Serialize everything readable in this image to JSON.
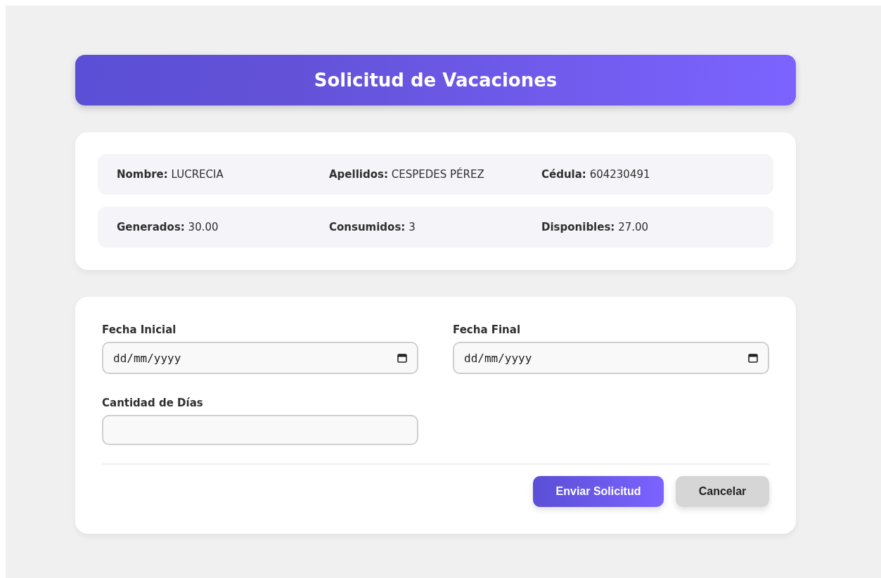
{
  "header": {
    "title": "Solicitud de Vacaciones"
  },
  "info_rows": [
    {
      "items": [
        {
          "label": "Nombre:",
          "value": "LUCRECIA"
        },
        {
          "label": "Apellidos:",
          "value": "CESPEDES PÉREZ"
        },
        {
          "label": "Cédula:",
          "value": "604230491"
        }
      ]
    },
    {
      "items": [
        {
          "label": "Generados:",
          "value": "30.00"
        },
        {
          "label": "Consumidos:",
          "value": "3"
        },
        {
          "label": "Disponibles:",
          "value": "27.00"
        }
      ]
    }
  ],
  "form": {
    "fields": [
      {
        "kind": "date",
        "label": "Fecha Inicial",
        "placeholder": "dd/mm/yyyy"
      },
      {
        "kind": "date",
        "label": "Fecha Final",
        "placeholder": "dd/mm/yyyy"
      },
      {
        "kind": "number",
        "label": "Cantidad de Días"
      }
    ],
    "buttons": [
      {
        "kind": "primary",
        "label": "Enviar Solicitud"
      },
      {
        "kind": "secondary",
        "label": "Cancelar"
      }
    ]
  }
}
